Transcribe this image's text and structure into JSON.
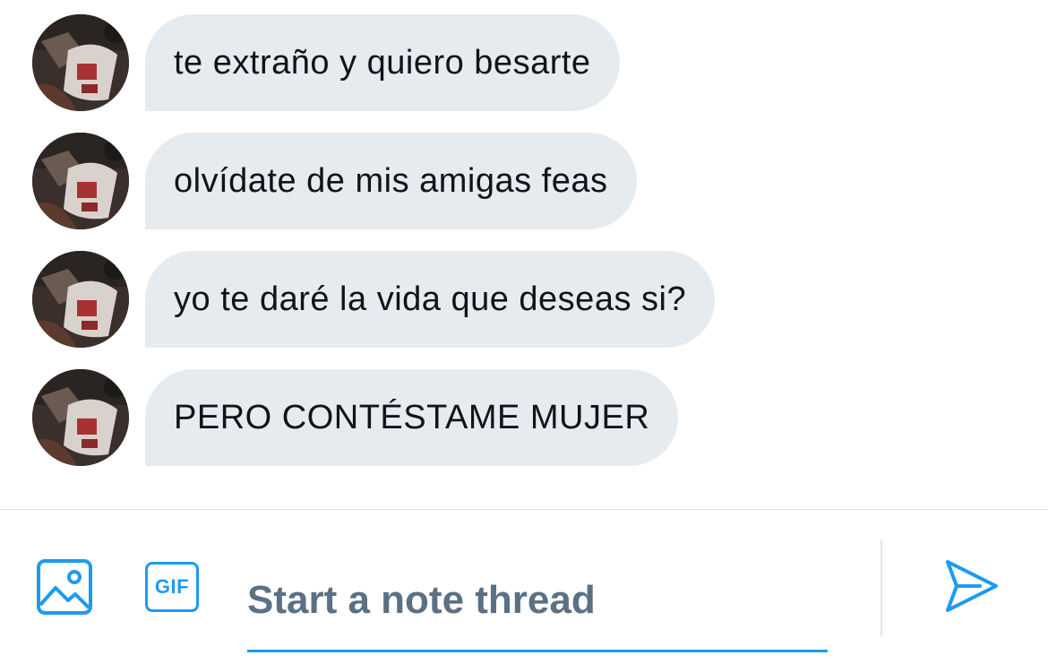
{
  "messages": [
    {
      "text": "te extraño y quiero besarte",
      "avatar_icon": "user-avatar"
    },
    {
      "text": "olvídate de mis amigas feas",
      "avatar_icon": "user-avatar"
    },
    {
      "text": "yo te daré la vida que deseas si?",
      "avatar_icon": "user-avatar"
    },
    {
      "text": "PERO CONTÉSTAME MUJER",
      "avatar_icon": "user-avatar"
    }
  ],
  "composer": {
    "media_icon": "image-icon",
    "gif_label": "GIF",
    "input_value": "",
    "input_placeholder": "Start a note thread",
    "send_icon": "send-icon"
  },
  "colors": {
    "accent": "#1d9bf0",
    "bubble_bg": "#e6ebef",
    "text": "#0f1419",
    "placeholder": "#5b7083"
  }
}
